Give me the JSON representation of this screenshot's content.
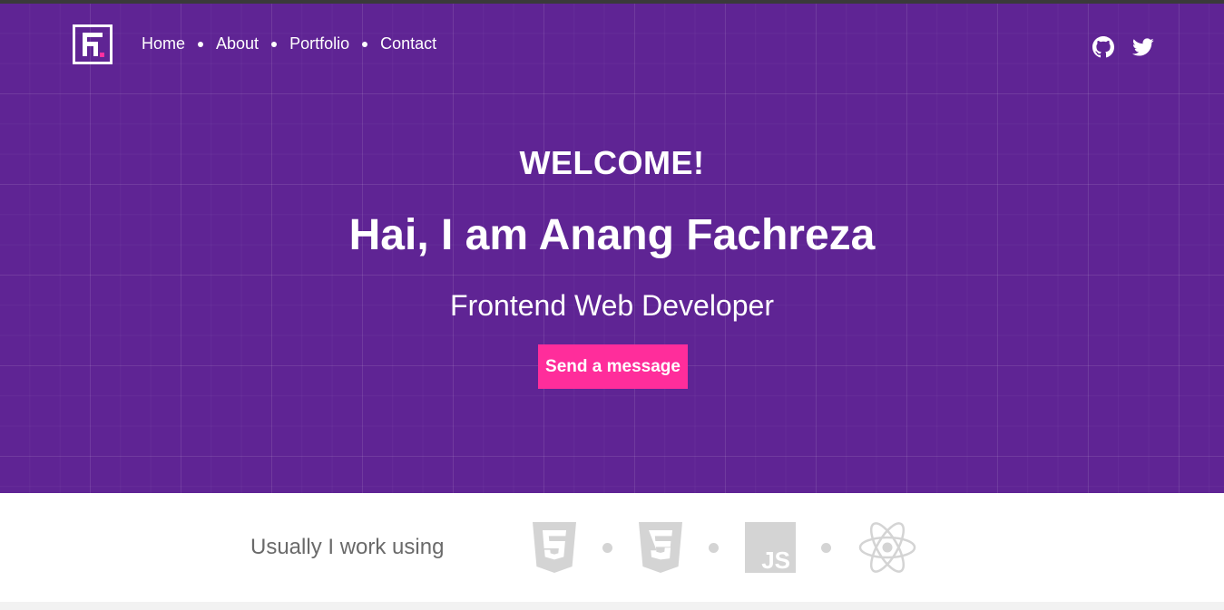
{
  "nav": {
    "items": [
      {
        "label": "Home"
      },
      {
        "label": "About"
      },
      {
        "label": "Portfolio"
      },
      {
        "label": "Contact"
      }
    ],
    "social": [
      "github-icon",
      "twitter-icon"
    ]
  },
  "hero": {
    "welcome": "WELCOME!",
    "name": "Hai, I am Anang Fachreza",
    "role": "Frontend Web Developer",
    "cta_label": "Send a message"
  },
  "tech": {
    "label": "Usually I work using",
    "icons": [
      "html5-icon",
      "css3-icon",
      "javascript-icon",
      "react-icon"
    ]
  },
  "colors": {
    "hero_bg": "#5f2494",
    "accent": "#ff2d9b",
    "tech_icon": "#d4d4d4"
  }
}
